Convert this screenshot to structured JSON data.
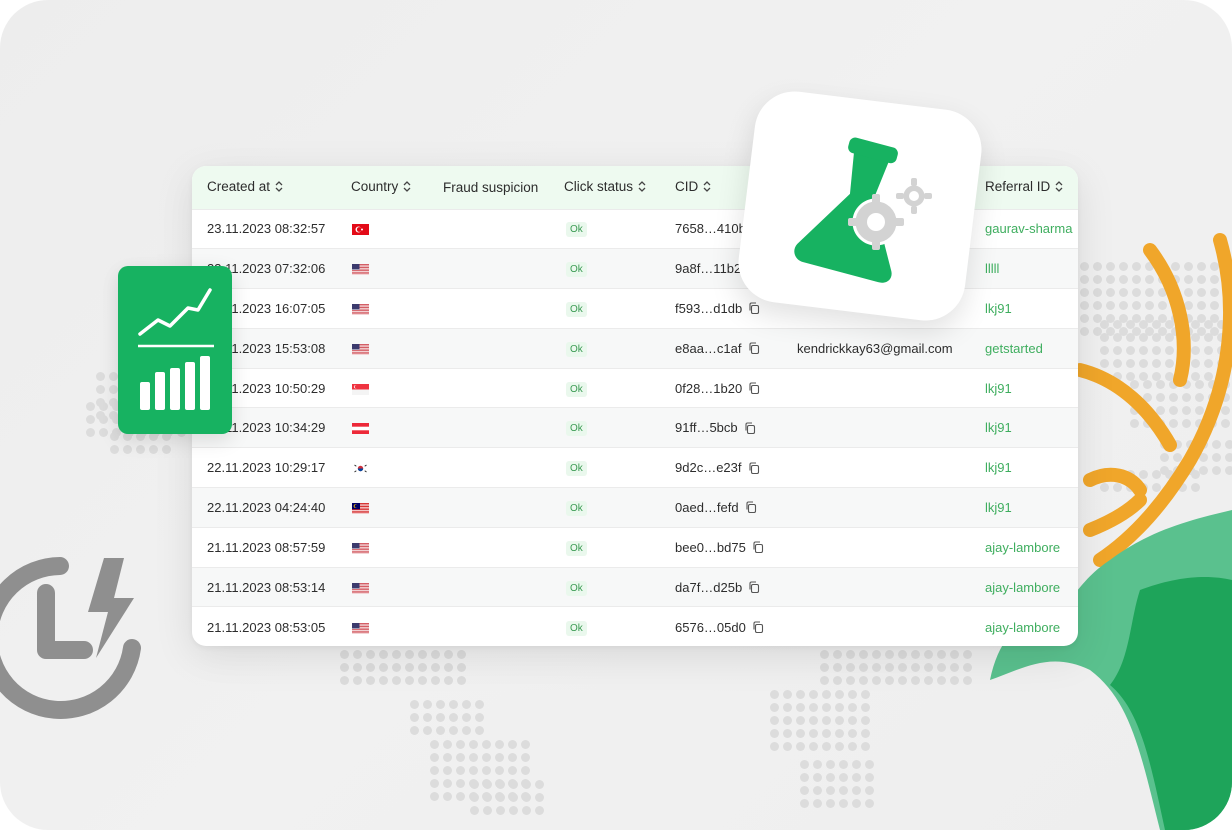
{
  "table": {
    "columns": [
      {
        "label": "Created at",
        "sortable": true
      },
      {
        "label": "Country",
        "sortable": true
      },
      {
        "label": "Fraud suspicion",
        "sortable": false
      },
      {
        "label": "Click status",
        "sortable": true
      },
      {
        "label": "CID",
        "sortable": true
      },
      {
        "label": "",
        "sortable": false
      },
      {
        "label": "Referral ID",
        "sortable": true
      }
    ],
    "rows": [
      {
        "created": "23.11.2023 08:32:57",
        "country": "turkey-flag",
        "status": "Ok",
        "cid": "7658…410b",
        "email": "",
        "referral": "gaurav-sharma"
      },
      {
        "created": "23.11.2023 07:32:06",
        "country": "usa-flag",
        "status": "Ok",
        "cid": "9a8f…11b2",
        "email": "",
        "referral": "lllll"
      },
      {
        "created": "22.11.2023 16:07:05",
        "country": "usa-flag",
        "status": "Ok",
        "cid": "f593…d1db",
        "email": "",
        "referral": "lkj91"
      },
      {
        "created": "22.11.2023 15:53:08",
        "country": "usa-flag",
        "status": "Ok",
        "cid": "e8aa…c1af",
        "email": "kendrickkay63@gmail.com",
        "referral": "getstarted"
      },
      {
        "created": "22.11.2023 10:50:29",
        "country": "singapore-flag",
        "status": "Ok",
        "cid": "0f28…1b20",
        "email": "",
        "referral": "lkj91"
      },
      {
        "created": "22.11.2023 10:34:29",
        "country": "austria-flag",
        "status": "Ok",
        "cid": "91ff…5bcb",
        "email": "",
        "referral": "lkj91"
      },
      {
        "created": "22.11.2023 10:29:17",
        "country": "south-korea-flag",
        "status": "Ok",
        "cid": "9d2c…e23f",
        "email": "",
        "referral": "lkj91"
      },
      {
        "created": "22.11.2023 04:24:40",
        "country": "malaysia-flag",
        "status": "Ok",
        "cid": "0aed…fefd",
        "email": "",
        "referral": "lkj91"
      },
      {
        "created": "21.11.2023 08:57:59",
        "country": "usa-flag",
        "status": "Ok",
        "cid": "bee0…bd75",
        "email": "",
        "referral": "ajay-lambore"
      },
      {
        "created": "21.11.2023 08:53:14",
        "country": "usa-flag",
        "status": "Ok",
        "cid": "da7f…d25b",
        "email": "",
        "referral": "ajay-lambore"
      },
      {
        "created": "21.11.2023 08:53:05",
        "country": "usa-flag",
        "status": "Ok",
        "cid": "6576…05d0",
        "email": "",
        "referral": "ajay-lambore"
      }
    ]
  },
  "decor": {
    "stats_icon": "analytics-chart-icon",
    "lab_icon": "lab-flask-gears-icon",
    "clock_icon": "clock-lightning-icon",
    "mascot": "deer-head-illustration",
    "colors": {
      "brand_green": "#17b261",
      "ok_text": "#3a9a52",
      "referral_link": "#3fae5f",
      "antler": "#f0a62a"
    }
  }
}
